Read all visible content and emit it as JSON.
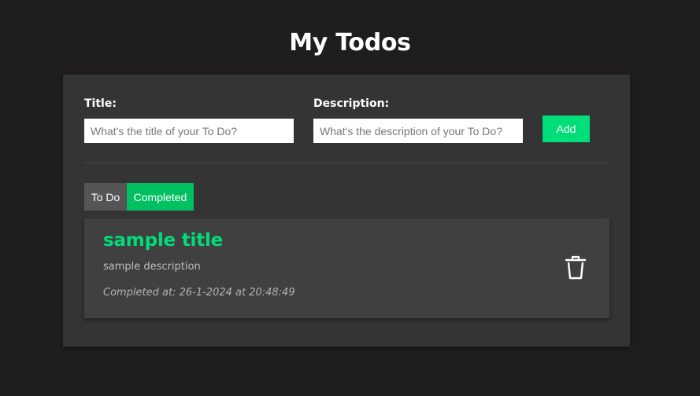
{
  "header": {
    "title": "My Todos"
  },
  "form": {
    "title_label": "Title:",
    "title_placeholder": "What's the title of your To Do?",
    "title_value": "",
    "description_label": "Description:",
    "description_placeholder": "What's the description of your To Do?",
    "description_value": "",
    "add_label": "Add"
  },
  "tabs": {
    "todo_label": "To Do",
    "completed_label": "Completed",
    "active": "Completed"
  },
  "todos": [
    {
      "title": "sample title",
      "description": "sample description",
      "completed_at": "Completed at: 26-1-2024 at 20:48:49",
      "delete_icon": "trash-icon"
    }
  ],
  "colors": {
    "background": "#1f1d1e",
    "panel": "#353434",
    "card": "#414041",
    "accent": "#00de79",
    "active_tab": "#00c062",
    "inactive_tab": "#555555"
  }
}
